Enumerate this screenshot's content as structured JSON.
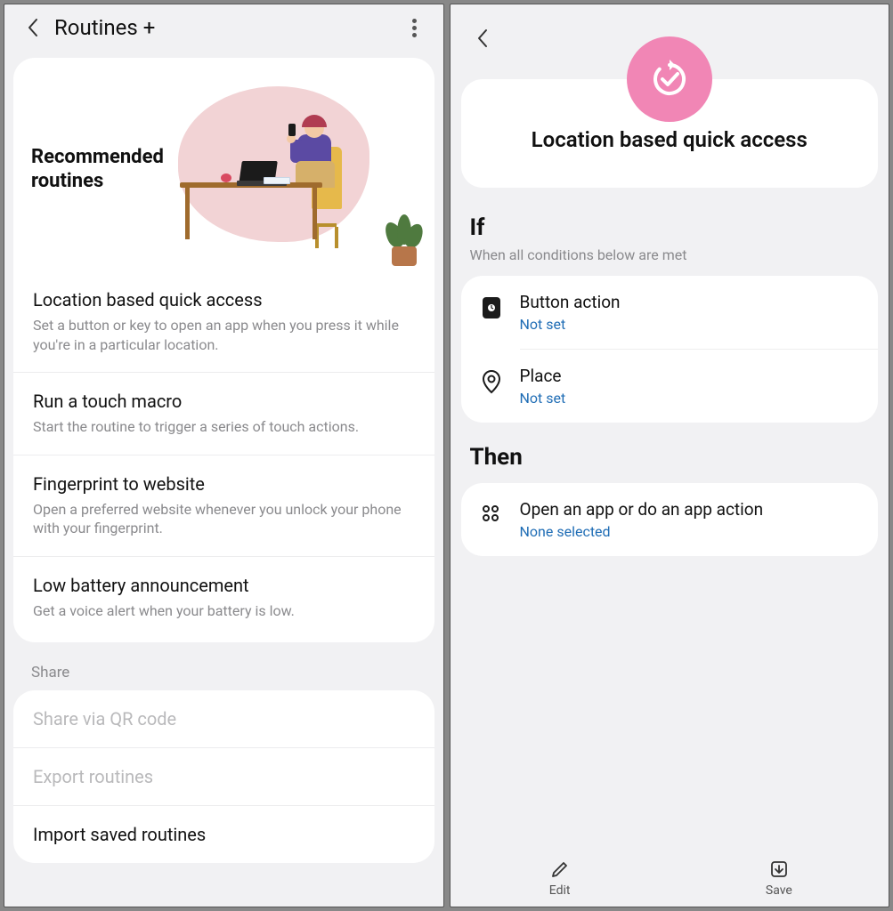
{
  "left": {
    "header_title": "Routines +",
    "recommended_heading": "Recommended routines",
    "routines": [
      {
        "title": "Location based quick access",
        "desc": "Set a button or key to open an app when you press it while you're in a particular location."
      },
      {
        "title": "Run a touch macro",
        "desc": "Start the routine to trigger a series of touch actions."
      },
      {
        "title": "Fingerprint to website",
        "desc": "Open a preferred website whenever you unlock your phone with your fingerprint."
      },
      {
        "title": "Low battery announcement",
        "desc": "Get a voice alert when your battery is low."
      }
    ],
    "share_label": "Share",
    "share_items": [
      {
        "label": "Share via QR code",
        "dim": true
      },
      {
        "label": "Export routines",
        "dim": true
      },
      {
        "label": "Import saved routines",
        "dim": false
      }
    ]
  },
  "right": {
    "hero_title": "Location based quick access",
    "if_title": "If",
    "if_subtitle": "When all conditions below are met",
    "conditions": [
      {
        "icon": "button-action-icon",
        "title": "Button action",
        "value": "Not set"
      },
      {
        "icon": "place-icon",
        "title": "Place",
        "value": "Not set"
      }
    ],
    "then_title": "Then",
    "action": {
      "title": "Open an app or do an app action",
      "value": "None selected"
    },
    "bottom": {
      "edit": "Edit",
      "save": "Save"
    }
  }
}
